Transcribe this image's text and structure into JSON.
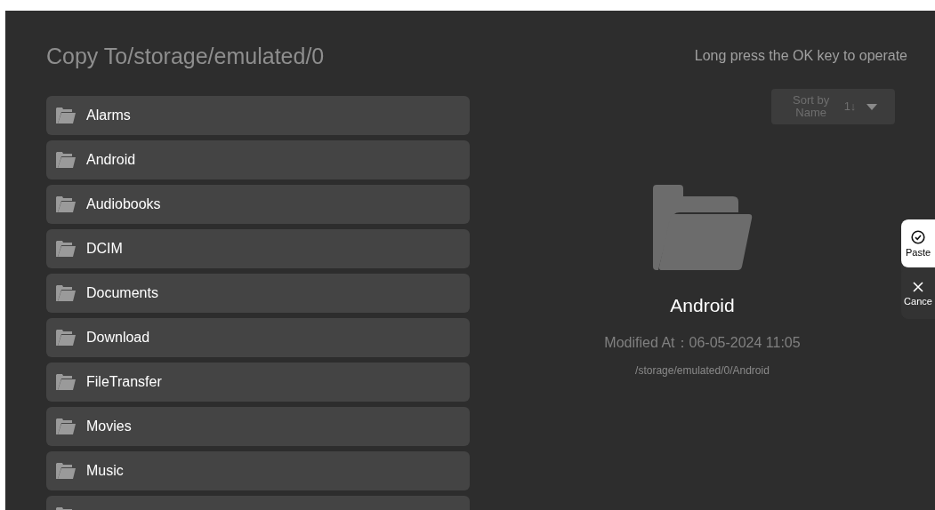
{
  "title": "Copy To/storage/emulated/0",
  "hint": "Long press the OK key to operate",
  "sort": {
    "label": "Sort by Name",
    "order": "1↓"
  },
  "folders": [
    {
      "name": "Alarms"
    },
    {
      "name": "Android"
    },
    {
      "name": "Audiobooks"
    },
    {
      "name": "DCIM"
    },
    {
      "name": "Documents"
    },
    {
      "name": "Download"
    },
    {
      "name": "FileTransfer"
    },
    {
      "name": "Movies"
    },
    {
      "name": "Music"
    }
  ],
  "details": {
    "name": "Android",
    "modified": "Modified At：06-05-2024 11:05",
    "path": "/storage/emulated/0/Android"
  },
  "actions": [
    {
      "kind": "paste",
      "label": "Paste",
      "selected": true
    },
    {
      "kind": "cancel",
      "label": "Cance",
      "selected": false
    }
  ]
}
